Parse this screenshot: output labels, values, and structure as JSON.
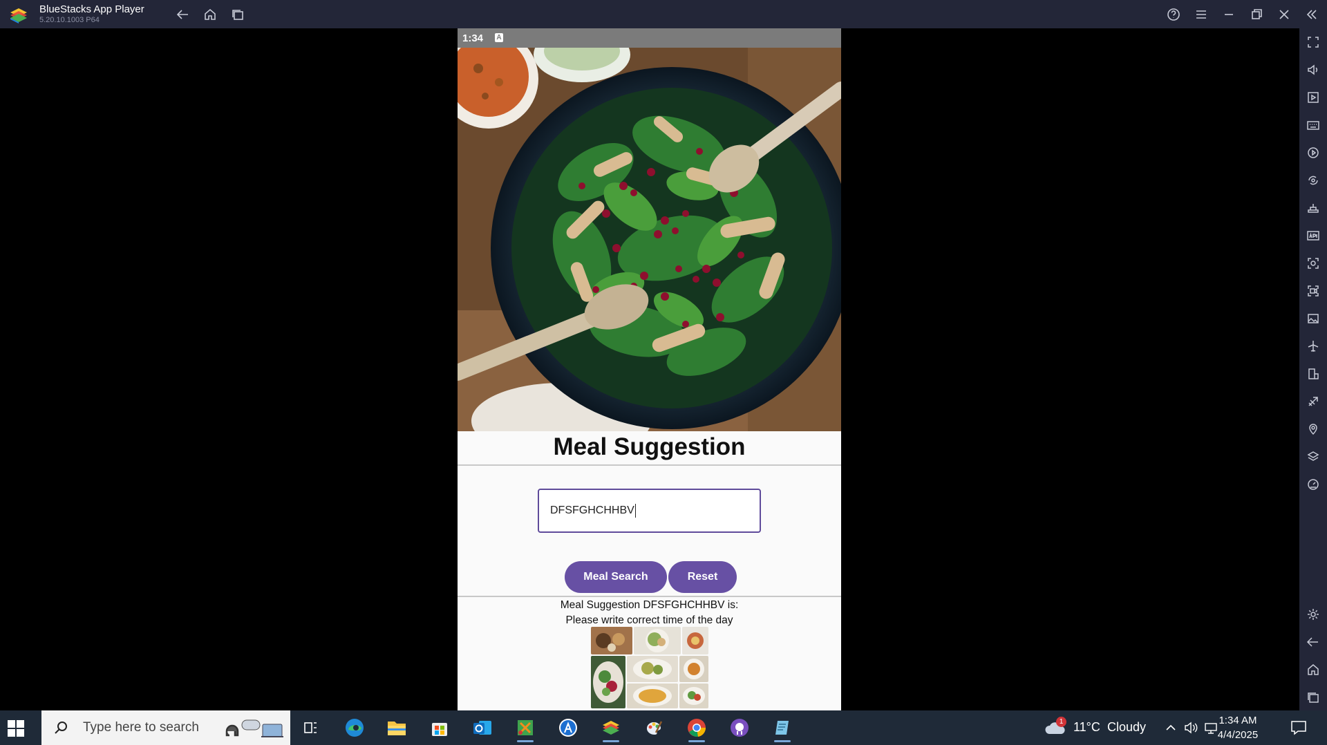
{
  "window": {
    "title": "BlueStacks App Player",
    "version": "5.20.10.1003  P64"
  },
  "titlebar_icons": [
    "back-icon",
    "home-icon",
    "recents-icon",
    "help-icon",
    "menu-icon",
    "minimize-icon",
    "restore-icon",
    "close-icon",
    "collapse-sidebar-icon"
  ],
  "sidebar_icons": [
    "fullscreen-icon",
    "volume-icon",
    "media-manager-icon",
    "keyboard-controls-icon",
    "macro-icon",
    "sync-icon",
    "game-controls-icon",
    "install-apk-icon",
    "screenshot-icon",
    "record-icon",
    "gallery-icon",
    "airplane-mode-icon",
    "multi-instance-icon",
    "eco-mode-icon",
    "location-icon",
    "layers-icon",
    "performance-icon",
    "settings-icon",
    "android-back-icon",
    "android-home-icon",
    "android-recents-icon"
  ],
  "status_bar": {
    "time": "1:34",
    "notification_letter": "A"
  },
  "app": {
    "title": "Meal Suggestion",
    "input_value": "DFSFGHCHHBV",
    "search_button": "Meal Search",
    "reset_button": "Reset",
    "result_line1": "Meal Suggestion DFSFGHCHHBV is:",
    "result_line2": "Please write correct time of the day"
  },
  "taskbar": {
    "search_placeholder": "Type here to search",
    "apps": [
      "task-view-icon",
      "edge-icon",
      "file-explorer-icon",
      "microsoft-store-icon",
      "outlook-icon",
      "snipping-tool-icon",
      "android-studio-icon",
      "bluestacks-icon",
      "paint-icon",
      "chrome-icon",
      "github-desktop-icon",
      "notepad-icon"
    ],
    "weather_temp": "11°C",
    "weather_text": "Cloudy",
    "weather_badge": "1",
    "time": "1:34 AM",
    "date": "4/4/2025"
  },
  "colors": {
    "accent": "#6750a4",
    "input_border": "#5e4a9a",
    "titlebar": "#232638",
    "taskbar": "#1f2a38"
  }
}
